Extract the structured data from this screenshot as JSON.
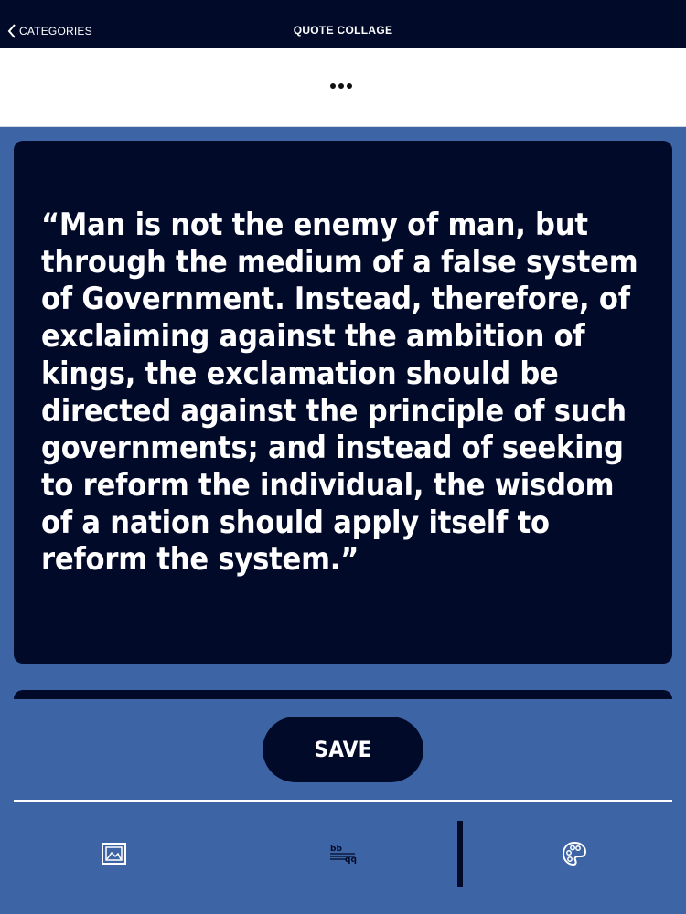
{
  "nav": {
    "back_label": "CATEGORIES",
    "title": "QUOTE COLLAGE"
  },
  "toolbar": {
    "more_icon": "ellipsis-icon"
  },
  "quote": {
    "text": "“Man is not the enemy of man, but\nthrough the medium of a false system\nof Government. Instead, therefore, of\nexclaiming against the ambition of\nkings, the exclamation should be\ndirected against the principle of such\ngovernments; and instead of seeking\nto reform the individual, the wisdom\nof a nation should apply itself to\nreform the system.”"
  },
  "actions": {
    "save_label": "SAVE"
  },
  "tools": [
    {
      "icon": "image-icon"
    },
    {
      "icon": "text-format-icon"
    },
    {
      "icon": "palette-icon"
    }
  ],
  "colors": {
    "navy": "#020a2a",
    "background_blue": "#3d65a6",
    "white": "#ffffff"
  }
}
